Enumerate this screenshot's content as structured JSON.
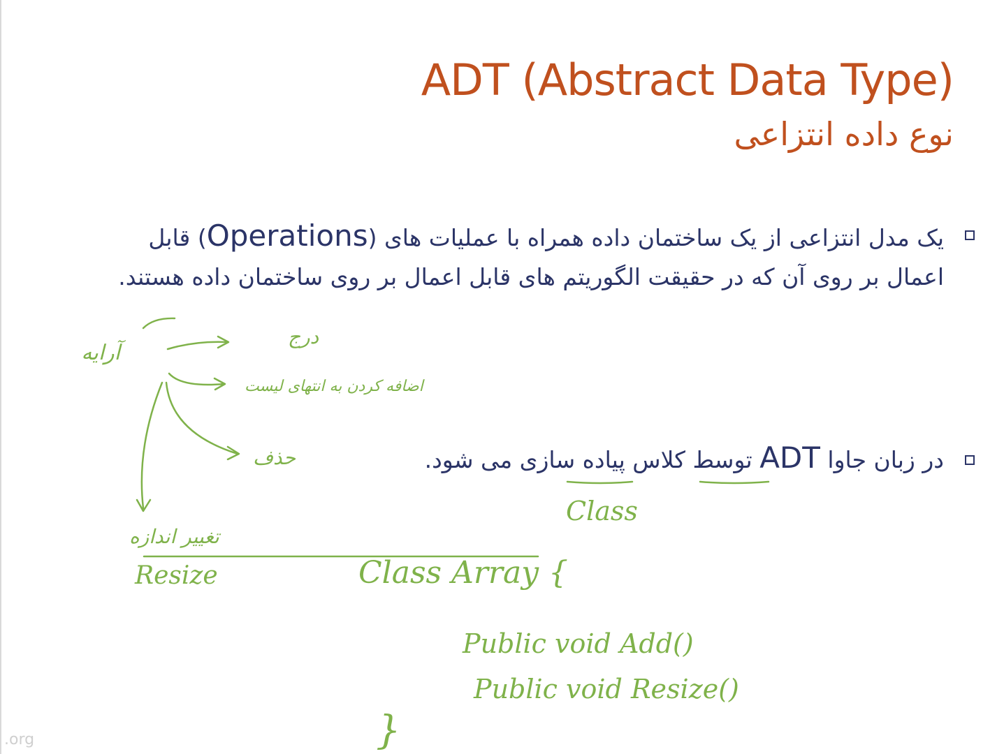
{
  "slide": {
    "title": "ADT (Abstract Data Type)",
    "subtitle": "نوع داده انتزاعی",
    "bullets": [
      {
        "text_before": "یک مدل انتزاعی از یک ساختمان داده همراه با عملیات های (",
        "term": "Operations",
        "text_after": ") قابل اعمال بر روی آن که در حقیقت الگوریتم های قابل اعمال بر روی ساختمان داده هستند."
      },
      {
        "text_before": "در زبان جاوا ",
        "term": "ADT",
        "text_after": " توسط کلاس پیاده سازی می شود."
      }
    ]
  },
  "annotations": {
    "array_label": "آرایه",
    "insert_label": "درج",
    "add_label": "اضافه کردن به انتهای لیست",
    "delete_label": "حذف",
    "resize_fa": "تغییر اندازه",
    "resize_en": "Resize",
    "class_word": "Class",
    "class_array": "Class Array {",
    "method_add": "Public void Add()",
    "method_resize": "Public void Resize()",
    "closing_brace": "}"
  },
  "watermark": ".org",
  "colors": {
    "title": "#c0501e",
    "body": "#2b3467",
    "ink": "#7fb24a"
  }
}
